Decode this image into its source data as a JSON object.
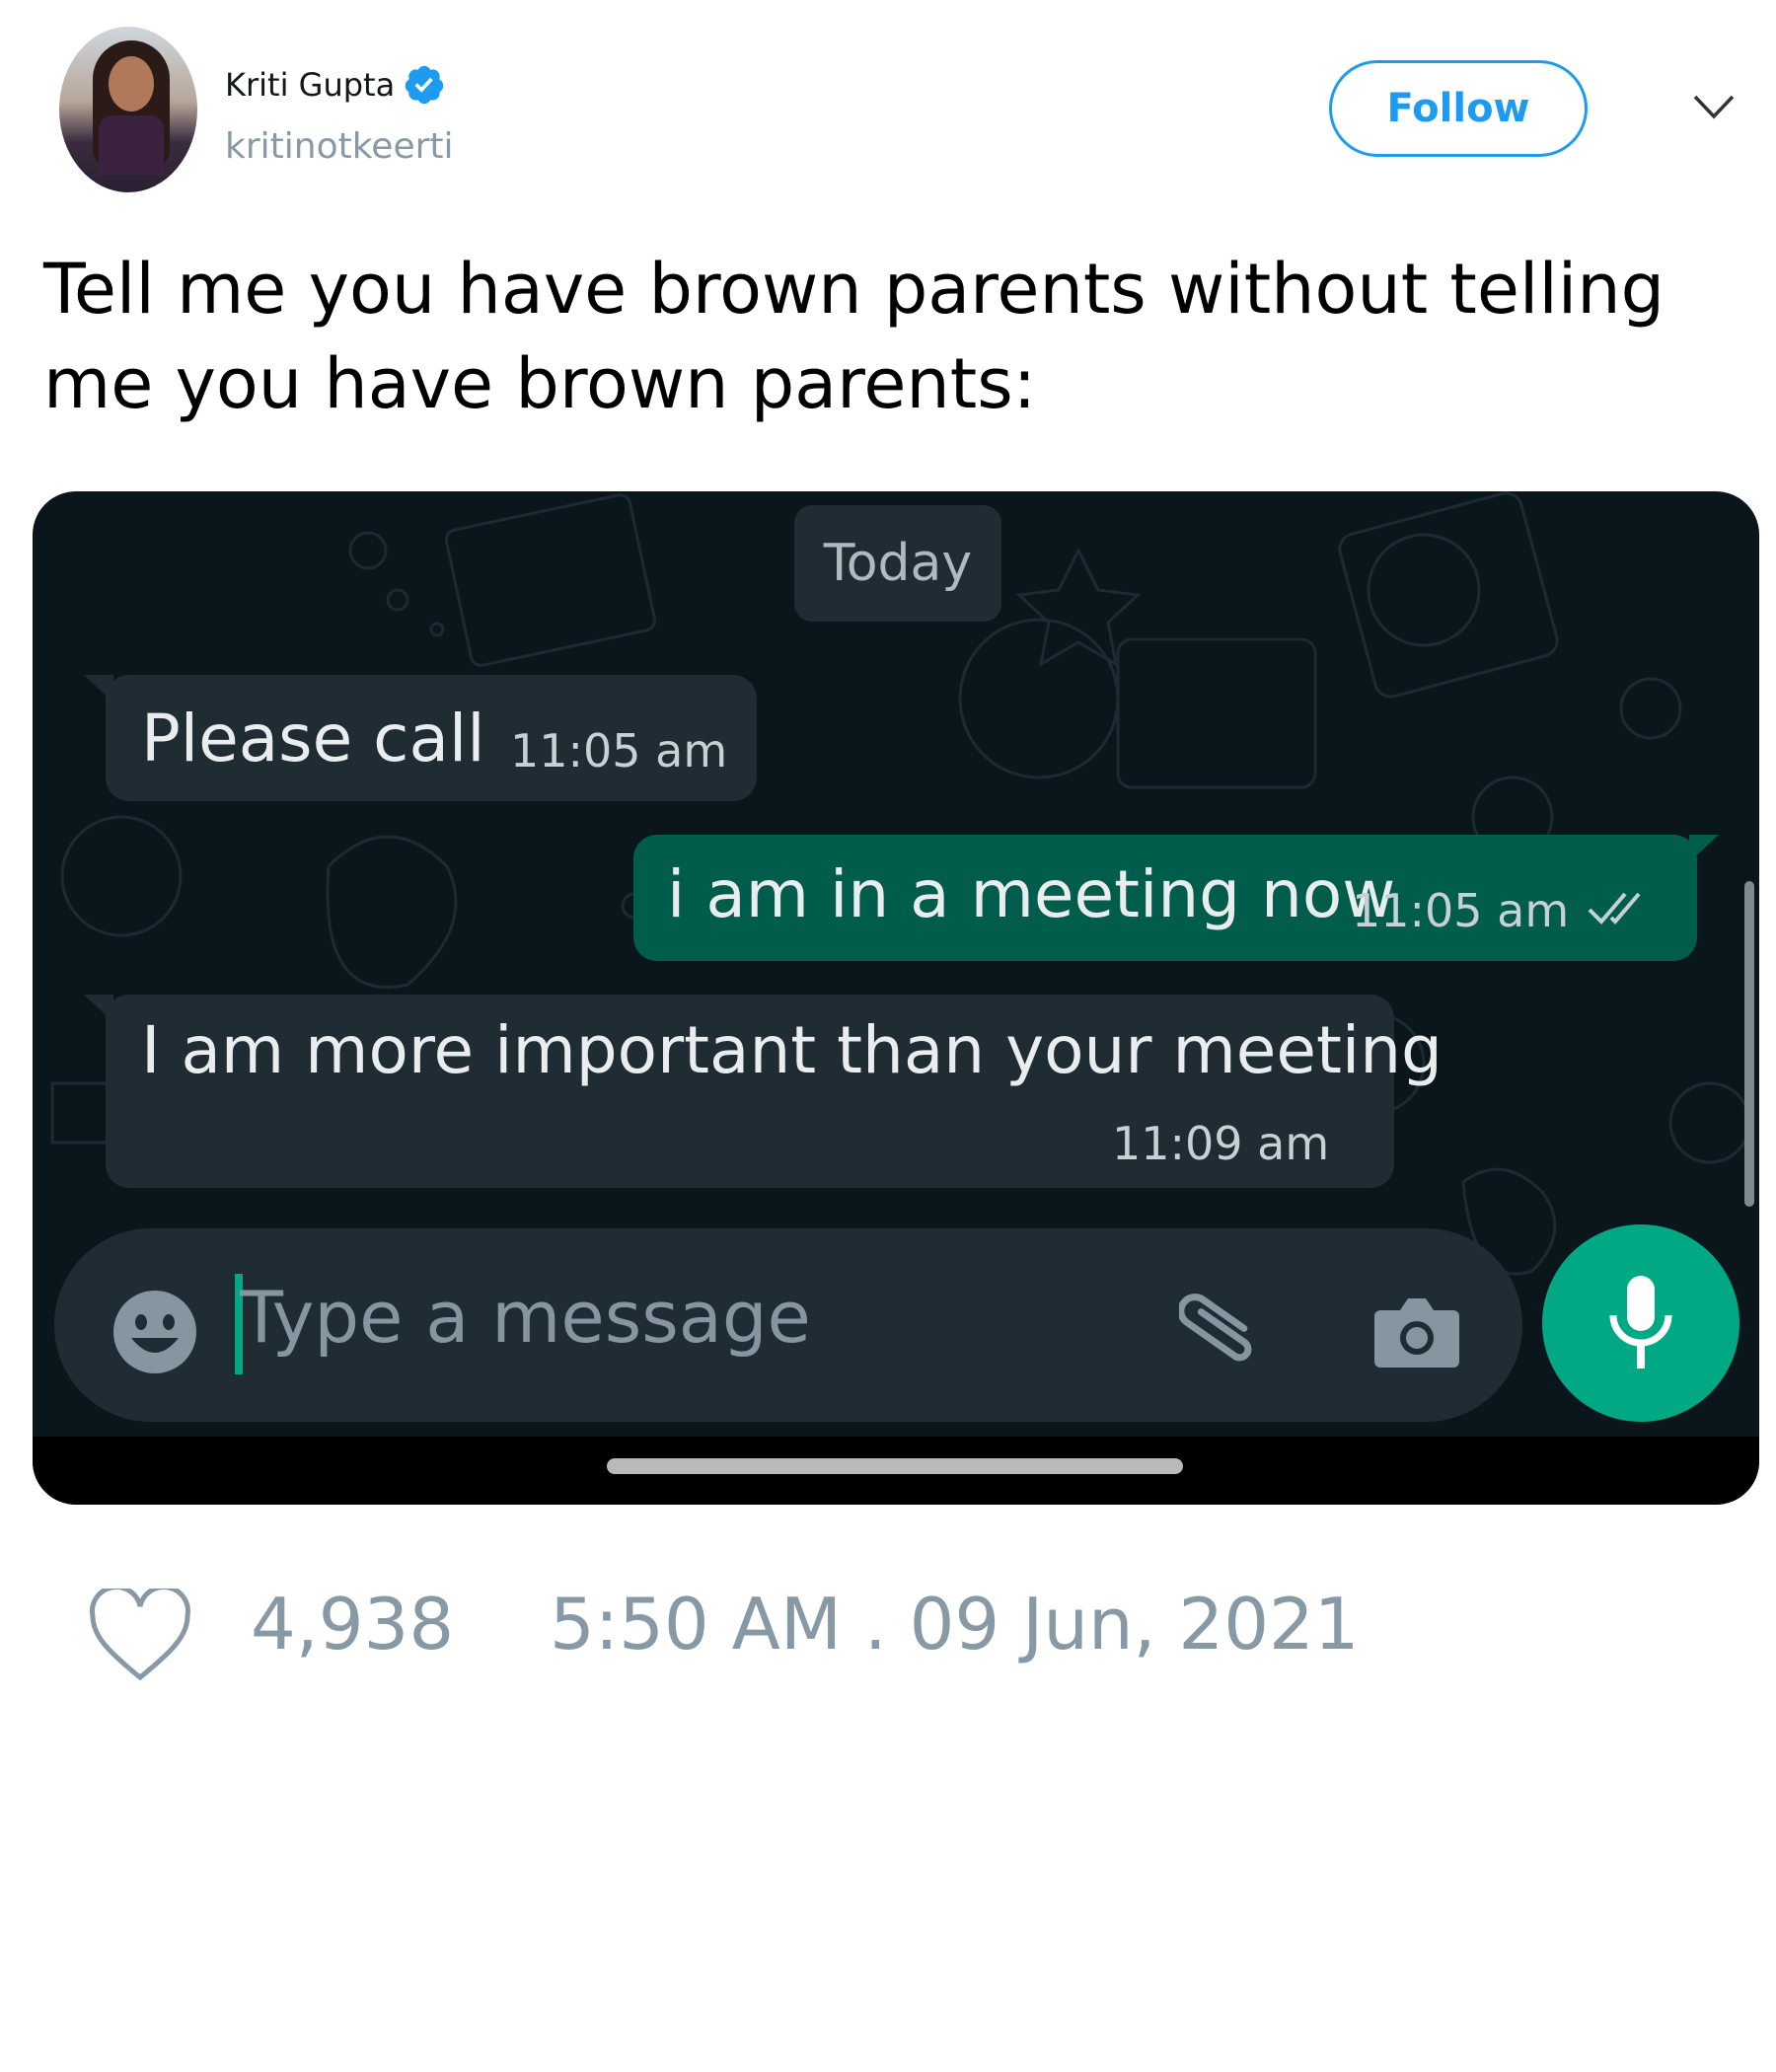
{
  "header": {
    "name": "Kriti Gupta",
    "handle": "kritinotkeerti",
    "follow_label": "Follow",
    "verified_icon": "verified-badge-icon",
    "menu_icon": "chevron-down-icon"
  },
  "tweet": {
    "text": "Tell me you have brown parents without telling me you have brown parents:"
  },
  "chat": {
    "date_divider": "Today",
    "messages": [
      {
        "direction": "incoming",
        "text": "Please call",
        "time": "11:05 am"
      },
      {
        "direction": "outgoing",
        "text": "i am in a meeting now",
        "time": "11:05 am",
        "status_icon": "double-check-icon"
      },
      {
        "direction": "incoming",
        "text": "I am more important than your meeting",
        "time": "11:09 am"
      }
    ],
    "input": {
      "placeholder": "Type a message",
      "emoji_icon": "smiley-icon",
      "attach_icon": "paperclip-icon",
      "camera_icon": "camera-icon",
      "send_icon": "microphone-icon"
    }
  },
  "footer": {
    "like_icon": "heart-icon",
    "likes": "4,938",
    "timestamp": "5:50 AM . 09 Jun, 2021"
  },
  "colors": {
    "twitter_blue": "#1d9bf0",
    "chat_background": "#0b161c",
    "incoming_bubble": "#1f2c34",
    "outgoing_bubble": "#005c4b",
    "mic_button": "#00a884",
    "muted_text": "#8899a6"
  }
}
